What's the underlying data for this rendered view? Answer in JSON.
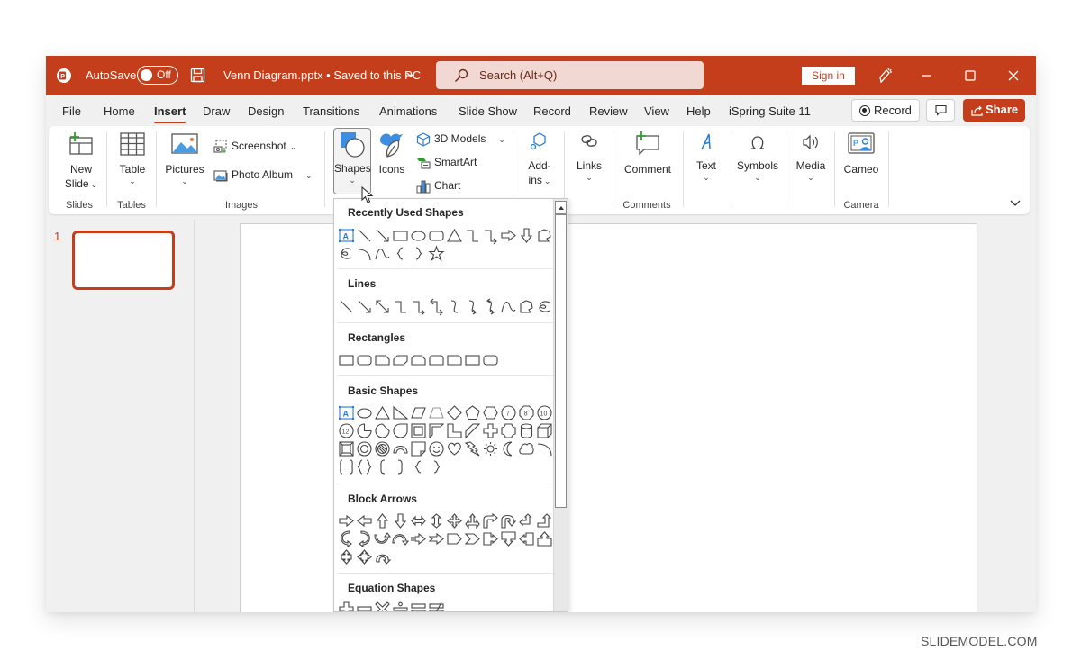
{
  "titlebar": {
    "autosave_label": "AutoSave",
    "autosave_state": "Off",
    "document_title": "Venn Diagram.pptx • Saved to this PC",
    "search_placeholder": "Search (Alt+Q)",
    "signin_label": "Sign in",
    "icons": [
      "powerpoint-logo-icon",
      "save-icon",
      "chevron-down-icon",
      "search-icon",
      "pen-icon",
      "minimize-icon",
      "maximize-icon",
      "close-icon"
    ]
  },
  "tabs": [
    {
      "label": "File"
    },
    {
      "label": "Home"
    },
    {
      "label": "Insert",
      "active": true
    },
    {
      "label": "Draw"
    },
    {
      "label": "Design"
    },
    {
      "label": "Transitions"
    },
    {
      "label": "Animations"
    },
    {
      "label": "Slide Show"
    },
    {
      "label": "Record"
    },
    {
      "label": "Review"
    },
    {
      "label": "View"
    },
    {
      "label": "Help"
    },
    {
      "label": "iSpring Suite 11"
    }
  ],
  "actions": {
    "record_label": "Record",
    "share_label": "Share"
  },
  "ribbon": {
    "new_slide": {
      "line1": "New",
      "line2": "Slide"
    },
    "table": "Table",
    "pictures": "Pictures",
    "screenshot": "Screenshot",
    "photo_album": "Photo Album",
    "shapes": "Shapes",
    "icons": "Icons",
    "models_3d": "3D Models",
    "smartart": "SmartArt",
    "chart": "Chart",
    "addins": {
      "line1": "Add-",
      "line2": "ins"
    },
    "links": "Links",
    "comment": "Comment",
    "text": "Text",
    "symbols": "Symbols",
    "media": "Media",
    "cameo": "Cameo",
    "groups": {
      "slides": "Slides",
      "tables": "Tables",
      "images": "Images",
      "comments": "Comments",
      "camera": "Camera"
    }
  },
  "slides_pane": {
    "slide_number": "1"
  },
  "shapes_gallery": {
    "sections": [
      {
        "title": "Recently Used Shapes",
        "count": 18
      },
      {
        "title": "Lines",
        "count": 12
      },
      {
        "title": "Rectangles",
        "count": 9
      },
      {
        "title": "Basic Shapes",
        "count": 42
      },
      {
        "title": "Block Arrows",
        "count": 27
      },
      {
        "title": "Equation Shapes",
        "count": 6
      }
    ]
  },
  "colors": {
    "brand": "#c43e1c",
    "accent_blue": "#2b7cd3"
  },
  "watermark": "SLIDEMODEL.COM"
}
